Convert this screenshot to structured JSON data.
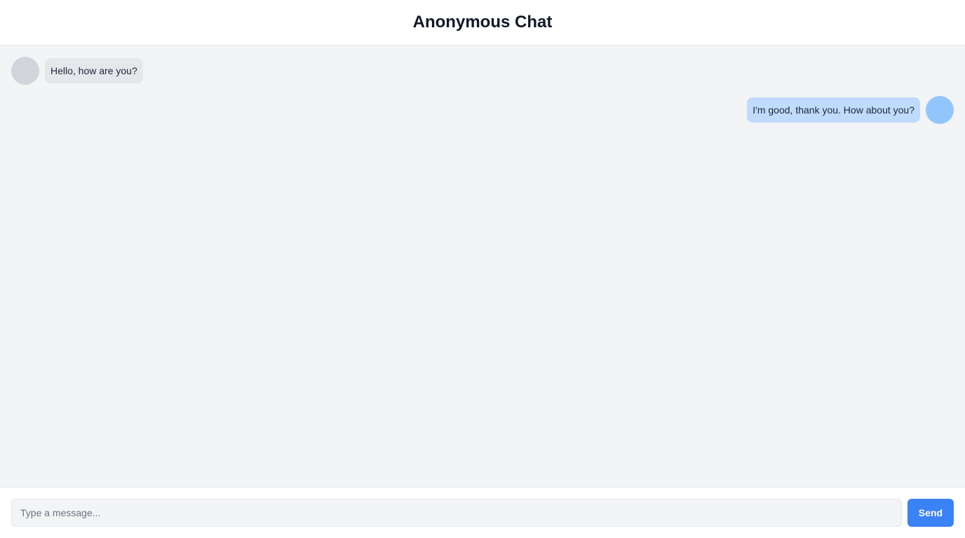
{
  "header": {
    "title": "Anonymous Chat"
  },
  "messages": [
    {
      "direction": "incoming",
      "text": "Hello, how are you?"
    },
    {
      "direction": "outgoing",
      "text": "I'm good, thank you. How about you?"
    }
  ],
  "composer": {
    "placeholder": "Type a message...",
    "value": "",
    "send_label": "Send"
  },
  "colors": {
    "accent": "#3b82f6",
    "incoming_bubble": "#e5e7eb",
    "outgoing_bubble": "#bfdbfe",
    "incoming_avatar": "#d1d5db",
    "outgoing_avatar": "#93c5fd"
  }
}
